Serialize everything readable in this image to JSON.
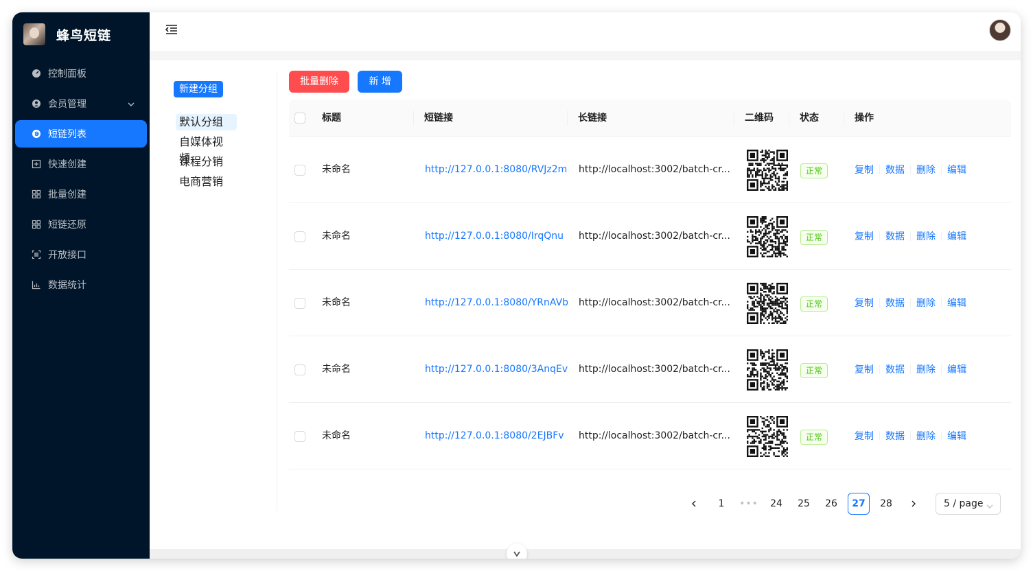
{
  "brand": {
    "name": "蜂鸟短链"
  },
  "menu": [
    {
      "key": "dashboard",
      "label": "控制面板",
      "icon": "dashboard-icon"
    },
    {
      "key": "members",
      "label": "会员管理",
      "icon": "members-icon",
      "has_submenu": true
    },
    {
      "key": "links",
      "label": "短链列表",
      "icon": "link-list-icon",
      "active": true
    },
    {
      "key": "quick",
      "label": "快速创建",
      "icon": "plus-square-icon"
    },
    {
      "key": "batch",
      "label": "批量创建",
      "icon": "batch-icon"
    },
    {
      "key": "restore",
      "label": "短链还原",
      "icon": "restore-icon"
    },
    {
      "key": "api",
      "label": "开放接口",
      "icon": "api-icon"
    },
    {
      "key": "stats",
      "label": "数据统计",
      "icon": "chart-icon"
    }
  ],
  "groups": {
    "new_label": "新建分组",
    "items": [
      "默认分组",
      "自媒体视频",
      "课程分销",
      "电商营销"
    ],
    "selected": "默认分组"
  },
  "toolbar": {
    "batch_delete": "批量删除",
    "add": "新 增"
  },
  "table": {
    "columns": [
      "标题",
      "短链接",
      "长链接",
      "二维码",
      "状态",
      "操作"
    ],
    "actions": [
      "复制",
      "数据",
      "删除",
      "编辑"
    ],
    "rows": [
      {
        "title": "未命名",
        "short": "http://127.0.0.1:8080/RVJz2m",
        "long": "http://localhost:3002/batch-cr...",
        "status": "正常"
      },
      {
        "title": "未命名",
        "short": "http://127.0.0.1:8080/IrqQnu",
        "long": "http://localhost:3002/batch-cr...",
        "status": "正常"
      },
      {
        "title": "未命名",
        "short": "http://127.0.0.1:8080/YRnAVb",
        "long": "http://localhost:3002/batch-cr...",
        "status": "正常"
      },
      {
        "title": "未命名",
        "short": "http://127.0.0.1:8080/3AnqEv",
        "long": "http://localhost:3002/batch-cr...",
        "status": "正常"
      },
      {
        "title": "未命名",
        "short": "http://127.0.0.1:8080/2EJBFv",
        "long": "http://localhost:3002/batch-cr...",
        "status": "正常"
      }
    ]
  },
  "pagination": {
    "pages": [
      "1",
      "•••",
      "24",
      "25",
      "26",
      "27",
      "28"
    ],
    "current": "27",
    "page_size": "5 / page"
  },
  "colors": {
    "sidebar": "#001529",
    "primary": "#1677ff",
    "danger": "#ff4d4f",
    "success": "#52c41a"
  }
}
